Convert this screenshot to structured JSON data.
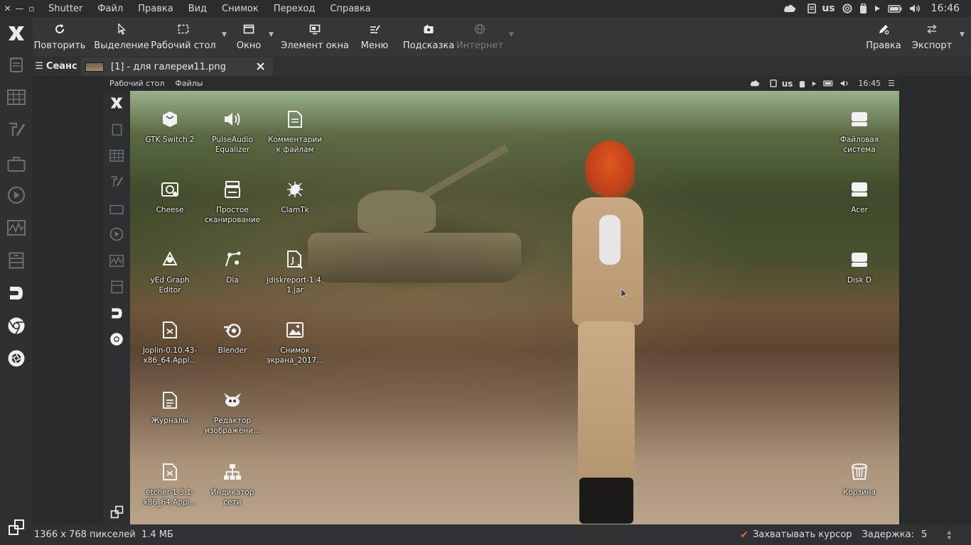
{
  "topbar": {
    "window_controls": [
      "✕",
      "—",
      "▫"
    ],
    "app_name": "Shutter",
    "menu": [
      "Файл",
      "Правка",
      "Вид",
      "Снимок",
      "Переход",
      "Справка"
    ],
    "keyboard_layout": "us",
    "clock": "16:46",
    "tray_icons": [
      "cloud-icon",
      "clipboard-icon",
      "keyboard-layout",
      "lifebuoy-icon",
      "usb-drive-icon",
      "play-icon",
      "battery-icon",
      "volume-icon"
    ]
  },
  "toolbar": {
    "buttons": [
      {
        "id": "repeat",
        "label": "Повторить",
        "icon": "refresh-icon"
      },
      {
        "id": "selection",
        "label": "Выделение",
        "icon": "cursor-icon"
      },
      {
        "id": "desktop",
        "label": "Рабочий стол",
        "icon": "desktop-icon"
      },
      {
        "id": "window",
        "label": "Окно",
        "icon": "window-icon"
      },
      {
        "id": "window-element",
        "label": "Элемент окна",
        "icon": "monitor-icon"
      },
      {
        "id": "menu",
        "label": "Меню",
        "icon": "menu-icon"
      },
      {
        "id": "tooltip",
        "label": "Подсказка",
        "icon": "tooltip-icon"
      },
      {
        "id": "internet",
        "label": "Интернет",
        "icon": "globe-icon",
        "disabled": true
      },
      {
        "id": "edit",
        "label": "Правка",
        "icon": "edit-icon"
      },
      {
        "id": "export",
        "label": "Экспорт",
        "icon": "export-icon"
      }
    ]
  },
  "tabs": {
    "session_label": "Сеанс",
    "file_tab_label": "[1] - для галереи11.png"
  },
  "screenshot": {
    "panel": {
      "menu": [
        "Рабочий стол",
        "Файлы"
      ],
      "keyboard_layout": "us",
      "clock": "16:45"
    },
    "desktop_icons": [
      {
        "label": "GTK Switch 2",
        "icon": "gtk-switch-icon"
      },
      {
        "label": "PulseAudio\nEqualizer",
        "icon": "speaker-icon"
      },
      {
        "label": "Комментарии\nк файлам",
        "icon": "document-icon"
      },
      {
        "label": "Cheese",
        "icon": "webcam-icon"
      },
      {
        "label": "Простое\nсканирование",
        "icon": "scanner-icon"
      },
      {
        "label": "ClamTk",
        "icon": "antivirus-icon"
      },
      {
        "label": "yEd Graph\nEditor",
        "icon": "graph-editor-icon"
      },
      {
        "label": "Dia",
        "icon": "diagram-icon"
      },
      {
        "label": "jdiskreport-1.4.\n1.jar",
        "icon": "jar-file-icon"
      },
      {
        "label": "Joplin-0.10.43-\nx86_64.Appl...",
        "icon": "appimage-icon"
      },
      {
        "label": "Blender",
        "icon": "blender-icon"
      },
      {
        "label": "Снимок\nэкрана_2017...",
        "icon": "image-file-icon"
      },
      {
        "label": "Журналы",
        "icon": "log-file-icon"
      },
      {
        "label": "Редактор\nизображени...",
        "icon": "gimp-icon"
      },
      {
        "label": "etcher-1.3.1-\nx86_64.Appl...",
        "icon": "appimage-icon"
      },
      {
        "label": "Индикатор\nсети",
        "icon": "network-icon"
      },
      {
        "label": "Файловая\nсистема",
        "icon": "drive-icon"
      },
      {
        "label": "Acer",
        "icon": "drive-icon"
      },
      {
        "label": "Disk D",
        "icon": "drive-icon"
      },
      {
        "label": "Корзина",
        "icon": "trash-icon"
      }
    ]
  },
  "status": {
    "image_info": "1366 x 768 пикселей  1.4 МБ",
    "capture_cursor_label": "Захватывать курсор",
    "delay_label": "Задержка:",
    "delay_value": "5"
  }
}
